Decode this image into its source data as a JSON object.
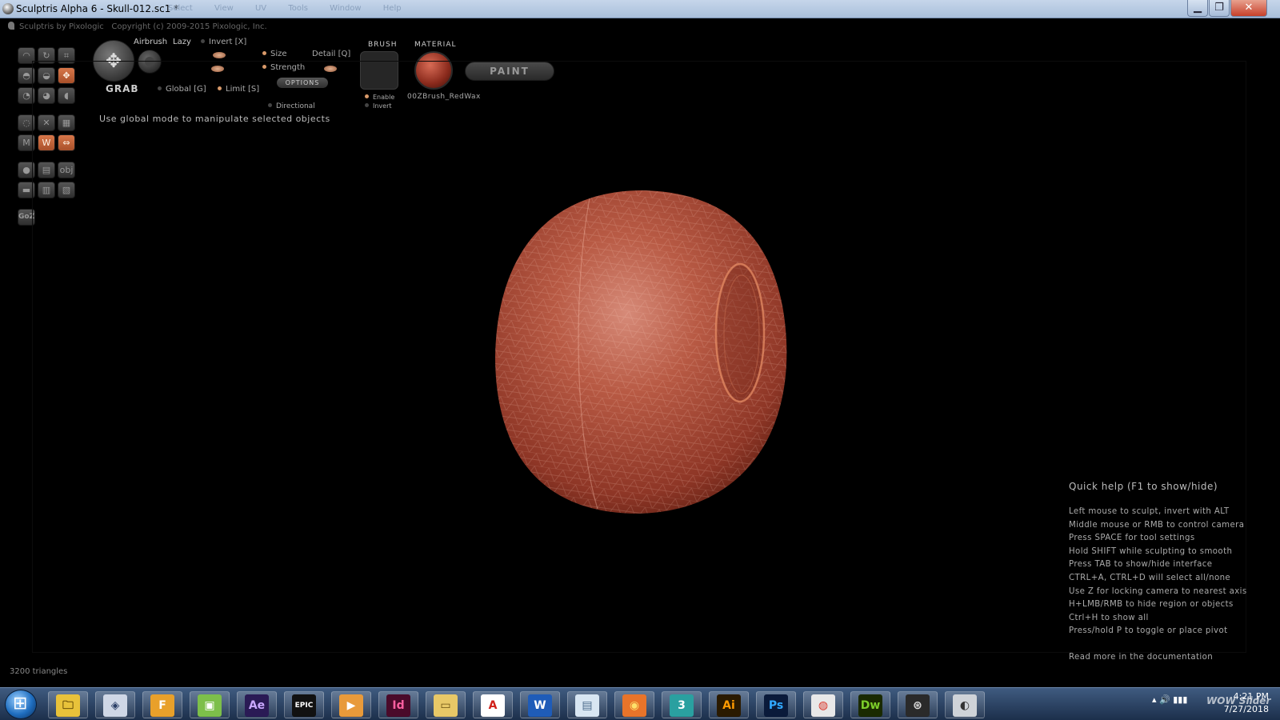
{
  "window": {
    "title": "Sculptris Alpha 6 - Skull-012.sc1 *",
    "menus": [
      "Select",
      "View",
      "UV",
      "Tools",
      "Window",
      "Help"
    ],
    "minimize": "▁",
    "maximize": "❐",
    "close": "✕"
  },
  "app": {
    "brand": "Sculptris by Pixologic",
    "copyright": "Copyright (c) 2009-2015 Pixologic, Inc."
  },
  "toolbar": {
    "tools": [
      {
        "name": "draw-tool",
        "glyph": "◠",
        "active": false
      },
      {
        "name": "rotate-tool",
        "glyph": "↻",
        "active": false
      },
      {
        "name": "scale-tool",
        "glyph": "⌗",
        "active": false
      },
      {
        "name": "inflate-tool",
        "glyph": "◓",
        "active": false
      },
      {
        "name": "pinch-tool",
        "glyph": "◒",
        "active": false
      },
      {
        "name": "grab-tool",
        "glyph": "✥",
        "active": true
      },
      {
        "name": "smooth-tool",
        "glyph": "◔",
        "active": false
      },
      {
        "name": "flatten-tool",
        "glyph": "◕",
        "active": false
      },
      {
        "name": "crease-tool",
        "glyph": "◖",
        "active": false
      },
      {
        "name": "reduce-brush-tool",
        "glyph": "◌",
        "active": false
      },
      {
        "name": "reduce-selection-tool",
        "glyph": "✕",
        "active": false
      },
      {
        "name": "subdivide-tool",
        "glyph": "▦",
        "active": false
      },
      {
        "name": "mask-tool",
        "glyph": "M",
        "active": false
      },
      {
        "name": "wireframe-tool",
        "glyph": "W",
        "active": true
      },
      {
        "name": "symmetry-tool",
        "glyph": "⇔",
        "active": true
      },
      {
        "name": "sphere-tool",
        "glyph": "●",
        "active": false
      },
      {
        "name": "import-tool",
        "glyph": "▤",
        "active": false
      },
      {
        "name": "export-tool",
        "glyph": "obj",
        "active": false
      },
      {
        "name": "plane-tool",
        "glyph": "▬",
        "active": false
      },
      {
        "name": "save-tool",
        "glyph": "▥",
        "active": false
      },
      {
        "name": "save-as-tool",
        "glyph": "▧",
        "active": false
      },
      {
        "name": "goz-tool",
        "glyph": "GoZ",
        "active": false
      }
    ]
  },
  "controls": {
    "grab_label": "GRAB",
    "grab_glyph": "✥",
    "airbrush": "Airbrush",
    "lazy": "Lazy",
    "invert": "Invert [X]",
    "size": "Size",
    "detail": "Detail [Q]",
    "strength": "Strength",
    "options": "OPTIONS",
    "global": "Global [G]",
    "limit": "Limit [S]",
    "directional": "Directional",
    "hint": "Use global mode to manipulate selected objects",
    "brush_heading": "BRUSH",
    "brush_enable": "Enable",
    "brush_invert": "Invert",
    "material_heading": "MATERIAL",
    "material_name": "00ZBrush_RedWax",
    "paint": "PAINT"
  },
  "quick_help": {
    "title": "Quick help (F1 to show/hide)",
    "items": [
      "Left mouse to sculpt, invert with ALT",
      "Middle mouse or RMB to control camera",
      "Press SPACE for tool settings",
      "Hold SHIFT while sculpting to smooth",
      "Press TAB to show/hide interface",
      "CTRL+A, CTRL+D will select all/none",
      "Use Z for locking camera to nearest axis",
      "H+LMB/RMB to hide region or objects",
      "Ctrl+H to show all",
      "Press/hold P to toggle or place pivot"
    ],
    "more": "Read more in the documentation"
  },
  "status": {
    "triangles": "3200 triangles"
  },
  "colors": {
    "accent": "#c8653a",
    "mesh": "#b04a36"
  },
  "taskbar": {
    "apps": [
      {
        "name": "file-explorer-icon",
        "label": "🗀",
        "bg": "#e8c23a",
        "fg": "#5a4000"
      },
      {
        "name": "3d-builder-icon",
        "label": "◈",
        "bg": "#cfd7e6",
        "fg": "#2b3f66"
      },
      {
        "name": "flash-icon",
        "label": "F",
        "bg": "#e8a02a",
        "fg": "#ffffff"
      },
      {
        "name": "photos-icon",
        "label": "▣",
        "bg": "#7dbf4a",
        "fg": "#ffffff"
      },
      {
        "name": "after-effects-icon",
        "label": "Ae",
        "bg": "#2a1a55",
        "fg": "#c9a8ff"
      },
      {
        "name": "epic-games-icon",
        "label": "EPIC",
        "bg": "#111111",
        "fg": "#ffffff"
      },
      {
        "name": "media-player-icon",
        "label": "▶",
        "bg": "#e89a3a",
        "fg": "#ffffff"
      },
      {
        "name": "indesign-icon",
        "label": "Id",
        "bg": "#4a0a2a",
        "fg": "#ff5fa0"
      },
      {
        "name": "folder-icon",
        "label": "▭",
        "bg": "#e8c867",
        "fg": "#6a5010"
      },
      {
        "name": "acrobat-icon",
        "label": "A",
        "bg": "#ffffff",
        "fg": "#d0201a"
      },
      {
        "name": "word-icon",
        "label": "W",
        "bg": "#1f5cb8",
        "fg": "#ffffff"
      },
      {
        "name": "pictures-icon",
        "label": "▤",
        "bg": "#d8e6f2",
        "fg": "#4a6a8a"
      },
      {
        "name": "firefox-icon",
        "label": "◉",
        "bg": "#e8742a",
        "fg": "#fde06a"
      },
      {
        "name": "3ds-max-icon",
        "label": "3",
        "bg": "#2aa0a0",
        "fg": "#ffffff"
      },
      {
        "name": "illustrator-icon",
        "label": "Ai",
        "bg": "#2a1a00",
        "fg": "#ff9a00"
      },
      {
        "name": "photoshop-icon",
        "label": "Ps",
        "bg": "#0a1a3a",
        "fg": "#31a8ff"
      },
      {
        "name": "chrome-icon",
        "label": "◍",
        "bg": "#e8e8e8",
        "fg": "#d93025"
      },
      {
        "name": "dreamweaver-icon",
        "label": "Dw",
        "bg": "#1a2a00",
        "fg": "#7ccd2a"
      },
      {
        "name": "app-shutter-icon",
        "label": "⊛",
        "bg": "#2a2a2a",
        "fg": "#dddddd"
      },
      {
        "name": "sculptris-icon",
        "label": "◐",
        "bg": "#cfd3d8",
        "fg": "#333333"
      }
    ],
    "tray": "▴  🔊  ▮▮▮",
    "time": "4:21 PM",
    "date": "7/27/2018",
    "watermark": "WOW Slider"
  }
}
